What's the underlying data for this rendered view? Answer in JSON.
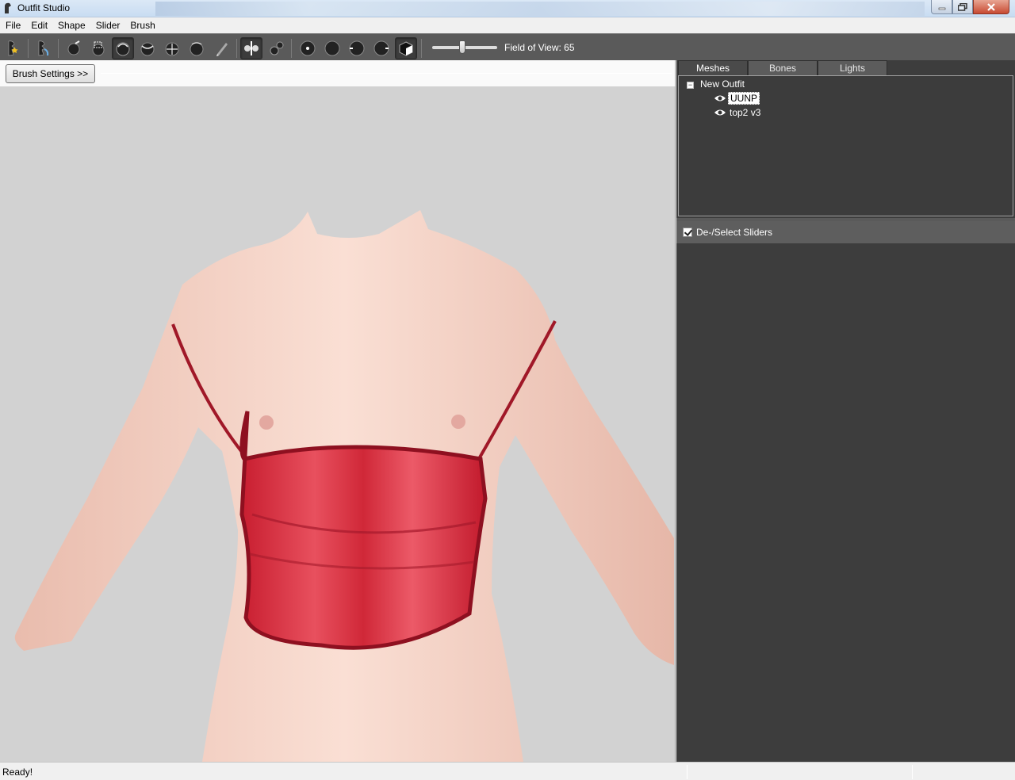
{
  "window": {
    "title": "Outfit Studio"
  },
  "menu": [
    "File",
    "Edit",
    "Shape",
    "Slider",
    "Brush"
  ],
  "toolbar": {
    "fov_label": "Field of View: 65",
    "fov_value": 65,
    "buttons": [
      {
        "name": "select-brush-icon"
      },
      {
        "name": "transform-brush-icon"
      },
      {
        "name": "mask-brush-icon"
      },
      {
        "name": "unmask-brush-icon"
      },
      {
        "name": "inflate-brush-icon"
      },
      {
        "name": "deflate-brush-icon"
      },
      {
        "name": "move-brush-icon"
      },
      {
        "name": "smooth-brush-icon"
      },
      {
        "name": "weight-brush-icon"
      },
      {
        "name": "x-mirror-icon"
      },
      {
        "name": "connected-only-icon"
      },
      {
        "name": "vertex-view-icon"
      },
      {
        "name": "wireframe-view-icon"
      },
      {
        "name": "lighting-view-icon"
      },
      {
        "name": "texture-view-icon"
      },
      {
        "name": "cube-view-icon"
      }
    ]
  },
  "brush_settings": {
    "label": "Brush Settings >>"
  },
  "right_panel": {
    "tabs": [
      "Meshes",
      "Bones",
      "Lights"
    ],
    "active_tab": "Meshes",
    "tree": {
      "root": "New Outfit",
      "items": [
        {
          "label": "UUNP",
          "selected": true
        },
        {
          "label": "top2 v3",
          "selected": false
        }
      ]
    },
    "slider_header": "De-/Select Sliders"
  },
  "status": {
    "text": "Ready!"
  },
  "colors": {
    "viewport_bg": "#d2d2d2",
    "panel_bg": "#3d3d3d",
    "toolbar_bg": "#5a5a5a",
    "garment": "#d8283a",
    "skin": "#f4d2c6"
  }
}
